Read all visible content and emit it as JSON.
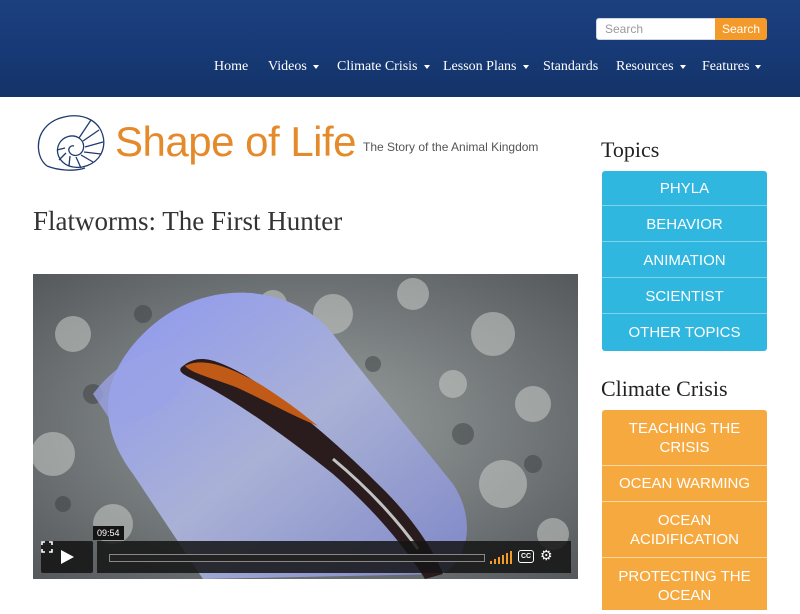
{
  "search": {
    "placeholder": "Search",
    "button_label": "Search"
  },
  "nav": {
    "items": [
      {
        "label": "Home",
        "dropdown": false
      },
      {
        "label": "Videos",
        "dropdown": true
      },
      {
        "label": "Climate Crisis",
        "dropdown": true
      },
      {
        "label": "Lesson Plans",
        "dropdown": true
      },
      {
        "label": "Standards",
        "dropdown": false
      },
      {
        "label": "Resources",
        "dropdown": true
      },
      {
        "label": "Features",
        "dropdown": true
      }
    ]
  },
  "logo": {
    "title": "Shape of Life",
    "tagline": "The Story of the Animal Kingdom",
    "icon": "nautilus-shell-icon"
  },
  "page": {
    "title": "Flatworms: The First Hunter"
  },
  "video": {
    "timecode": "09:54",
    "cc_label": "CC",
    "progress": 0
  },
  "sidebar": {
    "topics_heading": "Topics",
    "topics": [
      "PHYLA",
      "BEHAVIOR",
      "ANIMATION",
      "SCIENTIST",
      "OTHER TOPICS"
    ],
    "climate_heading": "Climate Crisis",
    "climate": [
      "TEACHING THE CRISIS",
      "OCEAN WARMING",
      "OCEAN ACIDIFICATION",
      "PROTECTING THE OCEAN"
    ]
  },
  "colors": {
    "header_bg": "#173a76",
    "accent_orange": "#f39a2b",
    "topics_blue": "#2fb7e0",
    "climate_orange": "#f6a93f",
    "logo_orange": "#e58a2b"
  }
}
